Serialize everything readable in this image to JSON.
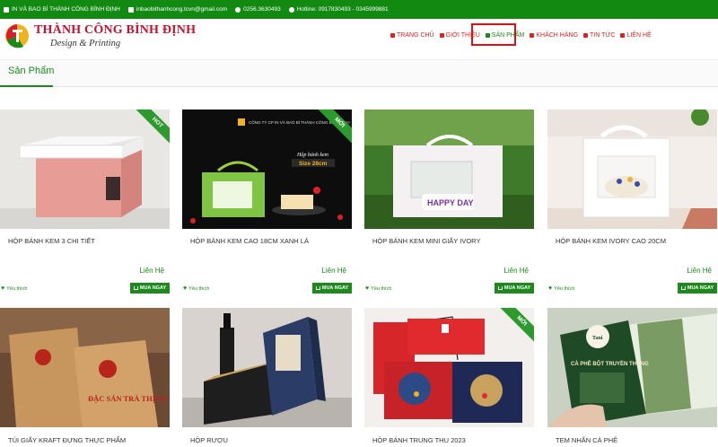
{
  "topbar": {
    "company": "IN VÀ BAO BÌ THÀNH CÔNG BÌNH ĐỊNH",
    "email": "inbaobithanhcong.tcvn@gmail.com",
    "phone": "0256.3630493",
    "hotline": "Hotline: 0917830493 - 0345999881"
  },
  "brand": {
    "name": "THÀNH CÔNG BÌNH ĐỊNH",
    "tagline": "Design & Printing",
    "logo_text": "THÀNH CÔNG"
  },
  "nav": {
    "items": [
      {
        "label": "TRANG CHỦ",
        "icon": "home-icon"
      },
      {
        "label": "GIỚI THIỆU",
        "icon": "info-icon"
      },
      {
        "label": "SẢN PHẨM",
        "icon": "products-icon",
        "active": true
      },
      {
        "label": "KHÁCH HÀNG",
        "icon": "customers-icon"
      },
      {
        "label": "TIN TỨC",
        "icon": "news-icon"
      },
      {
        "label": "LIÊN HỆ",
        "icon": "mail-icon"
      }
    ]
  },
  "section": {
    "title": "Sản Phẩm"
  },
  "products_row1": [
    {
      "name": "HỘP BÁNH KEM 3 CHI TIẾT",
      "price": "Liên Hệ",
      "fav": "Yêu thích",
      "buy": "MUA NGAY",
      "badge": "HOT"
    },
    {
      "name": "HỘP BÁNH KEM CAO 18CM XANH LÁ",
      "price": "Liên Hệ",
      "fav": "Yêu thích",
      "buy": "MUA NGAY",
      "badge": "MỚI",
      "img_header": "CÔNG TY CP IN VÀ BAO BÌ THÀNH CÔNG BÌNH ĐỊNH",
      "img_size": "Size 28cm",
      "img_script": "Hộp bánh kem"
    },
    {
      "name": "HỘP BÁNH KEM MINI GIẤY IVORY",
      "price": "Liên Hệ",
      "fav": "Yêu thích",
      "buy": "MUA NGAY",
      "badge": "",
      "img_sticker": "HAPPY DAY"
    },
    {
      "name": "HỘP BÁNH KEM IVORY CAO 20CM",
      "price": "Liên Hệ",
      "fav": "Yêu thích",
      "buy": "MUA NGAY",
      "badge": ""
    }
  ],
  "products_row2": [
    {
      "name": "TÚI GIẤY KRAFT ĐỰNG THỰC PHẨM",
      "badge": "",
      "img_text": "ĐẶC SẢN TRÀ THỊNH PHÁT"
    },
    {
      "name": "HỘP RƯỢU",
      "badge": ""
    },
    {
      "name": "HỘP BÁNH TRUNG THU 2023",
      "badge": "MỚI"
    },
    {
      "name": "TEM NHÃN CÀ PHÊ",
      "badge": "",
      "img_text": "CÀ PHÊ BỘT TRUYỀN THỐNG"
    }
  ],
  "colors": {
    "green": "#128a12",
    "red": "#c8102e",
    "highlight": "#e01010"
  }
}
